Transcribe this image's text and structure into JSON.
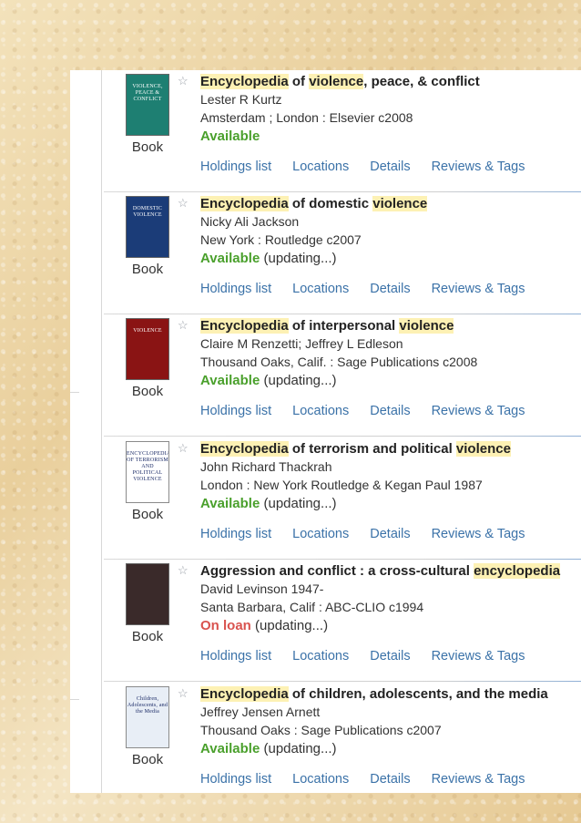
{
  "results": [
    {
      "title": [
        "Encyclopedia",
        " of ",
        "violence",
        ", peace, & conflict"
      ],
      "author": "Lester R Kurtz",
      "publisher": "Amsterdam ; London : Elsevier c2008",
      "status": "Available",
      "status_type": "available",
      "status_note": "",
      "format": "Book",
      "cover_text": "VIOLENCE, PEACE & CONFLICT",
      "cover_color": "#1e7f72"
    },
    {
      "title": [
        "Encyclopedia",
        " of ",
        "domestic ",
        "violence"
      ],
      "author": "Nicky Ali Jackson",
      "publisher": "New York : Routledge c2007",
      "status": "Available",
      "status_type": "available",
      "status_note": " (updating...)",
      "format": "Book",
      "cover_text": "DOMESTIC VIOLENCE",
      "cover_color": "#1b3c78"
    },
    {
      "title": [
        "Encyclopedia",
        " of ",
        "interpersonal ",
        "violence"
      ],
      "author": "Claire M Renzetti; Jeffrey L Edleson",
      "publisher": "Thousand Oaks, Calif. : Sage Publications c2008",
      "status": "Available",
      "status_type": "available",
      "status_note": " (updating...)",
      "format": "Book",
      "cover_text": "VIOLENCE",
      "cover_color": "#8a1414"
    },
    {
      "title": [
        "Encyclopedia",
        " of ",
        "terrorism and political ",
        "violence"
      ],
      "author": "John Richard Thackrah",
      "publisher": "London : New York Routledge & Kegan Paul 1987",
      "status": "Available",
      "status_type": "available",
      "status_note": " (updating...)",
      "format": "Book",
      "cover_text": "ENCYCLOPEDIA OF TERRORISM AND POLITICAL VIOLENCE",
      "cover_color": "#ffffff"
    },
    {
      "title": [
        "Aggression and conflict : a cross-cultural ",
        "encyclopedia",
        "",
        ""
      ],
      "author": "David Levinson 1947-",
      "publisher": "Santa Barbara, Calif : ABC-CLIO c1994",
      "status": "On loan",
      "status_type": "loan",
      "status_note": " (updating...)",
      "format": "Book",
      "cover_text": "",
      "cover_color": "#3a2a2a"
    },
    {
      "title": [
        "Encyclopedia",
        " of ",
        "children, adolescents, and the media",
        ""
      ],
      "author": "Jeffrey Jensen Arnett",
      "publisher": "Thousand Oaks : Sage Publications c2007",
      "status": "Available",
      "status_type": "available",
      "status_note": " (updating...)",
      "format": "Book",
      "cover_text": "Children, Adolescents, and the Media",
      "cover_color": "#e8eef6"
    }
  ],
  "links": {
    "holdings": "Holdings list",
    "locations": "Locations",
    "details": "Details",
    "reviews": "Reviews & Tags"
  },
  "colors": {
    "available": "#4aa02c",
    "on_loan": "#d9534f",
    "link": "#3b72a8",
    "highlight": "#fdf1b4"
  }
}
